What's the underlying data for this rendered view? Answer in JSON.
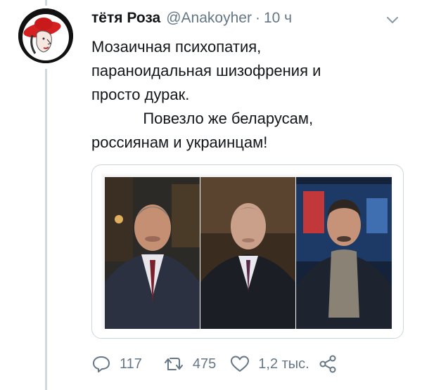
{
  "tweet": {
    "author_name": "тётя Роза",
    "handle": "@Anakoyher",
    "separator": "·",
    "time": "10 ч",
    "text": "Мозаичная психопатия,\nпараноидальная шизофрения и\nпросто дурак.\n            Повезло же беларусам,\nроссиянам и украинцам!"
  },
  "actions": {
    "replies": "117",
    "retweets": "475",
    "likes": "1,2 тыс."
  },
  "icons": {
    "menu": "chevron-down-icon",
    "reply": "reply-icon",
    "retweet": "retweet-icon",
    "like": "heart-icon",
    "share": "share-icon"
  },
  "colors": {
    "secondary_text": "#657786",
    "avatar_hat": "#d42020",
    "border": "#ccd6dd"
  }
}
